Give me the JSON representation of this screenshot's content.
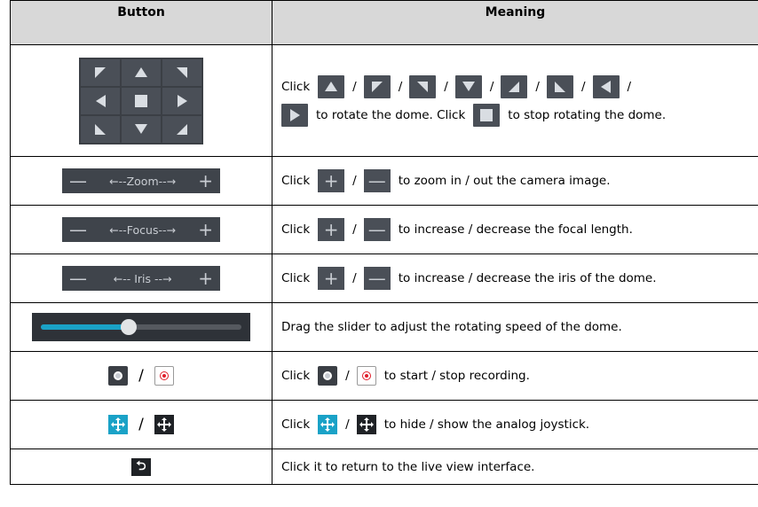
{
  "header": {
    "col_button": "Button",
    "col_meaning": "Meaning"
  },
  "rows": {
    "direction": {
      "pre": "Click",
      "slash": "/",
      "line2": "to rotate the dome. Click",
      "line2_end": "to stop rotating the dome."
    },
    "zoom": {
      "bar_label": "←--Zoom--→",
      "pre": "Click",
      "slash": "/",
      "post": "to zoom in / out the camera image."
    },
    "focus": {
      "bar_label": "←--Focus--→",
      "pre": "Click",
      "slash": "/",
      "post": "to increase / decrease the focal length."
    },
    "iris": {
      "bar_label": "←-- Iris --→",
      "pre": "Click",
      "slash": "/",
      "post": "to increase / decrease the iris of the dome."
    },
    "speed": {
      "meaning": "Drag the slider to adjust the rotating speed of the dome.",
      "slider_value_fraction": 0.44
    },
    "record": {
      "slash": "/",
      "pre": "Click",
      "post": "to start / stop recording."
    },
    "joystick": {
      "slash": "/",
      "pre": "Click",
      "post": "to hide / show the analog joystick."
    },
    "back": {
      "icon_char": "⮌",
      "meaning": "Click it to return to the live view interface."
    }
  },
  "icons": {
    "plus": "+",
    "minus": "—"
  },
  "colors": {
    "header_bg": "#d8d8d8",
    "tile_bg": "#4a4f57",
    "accent_teal": "#1aa2c7",
    "record_red": "#e01e2a"
  }
}
